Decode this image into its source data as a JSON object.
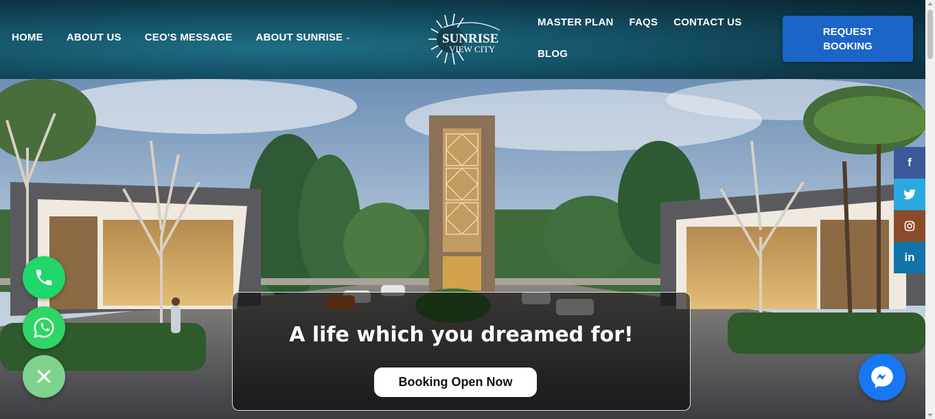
{
  "header": {
    "nav_left": [
      {
        "label": "HOME"
      },
      {
        "label": "ABOUT US"
      },
      {
        "label": "CEO'S MESSAGE"
      },
      {
        "label": "ABOUT SUNRISE"
      }
    ],
    "nav_right": [
      {
        "label": "MASTER PLAN"
      },
      {
        "label": "FAQS"
      },
      {
        "label": "CONTACT US"
      },
      {
        "label": "BLOG"
      }
    ],
    "logo": {
      "line1": "SUNRISE",
      "line2": "VIEW CITY"
    },
    "request_button": {
      "line1": "REQUEST",
      "line2": "BOOKING"
    }
  },
  "hero": {
    "headline": "A life which you dreamed for!",
    "cta_label": "Booking Open Now"
  },
  "social": [
    {
      "icon": "facebook-icon",
      "glyph": "f",
      "color": "#3b5998"
    },
    {
      "icon": "twitter-icon",
      "glyph": "🐦",
      "color": "#2aa9e0"
    },
    {
      "icon": "instagram-icon",
      "glyph": "◎",
      "color": "#8a4b2a"
    },
    {
      "icon": "linkedin-icon",
      "glyph": "in",
      "color": "#1273a8"
    }
  ],
  "colors": {
    "accent_blue": "#1b64c8",
    "phone_green": "#1fd76a",
    "whatsapp_green": "#2fd566",
    "messenger_blue": "#1877f2"
  }
}
